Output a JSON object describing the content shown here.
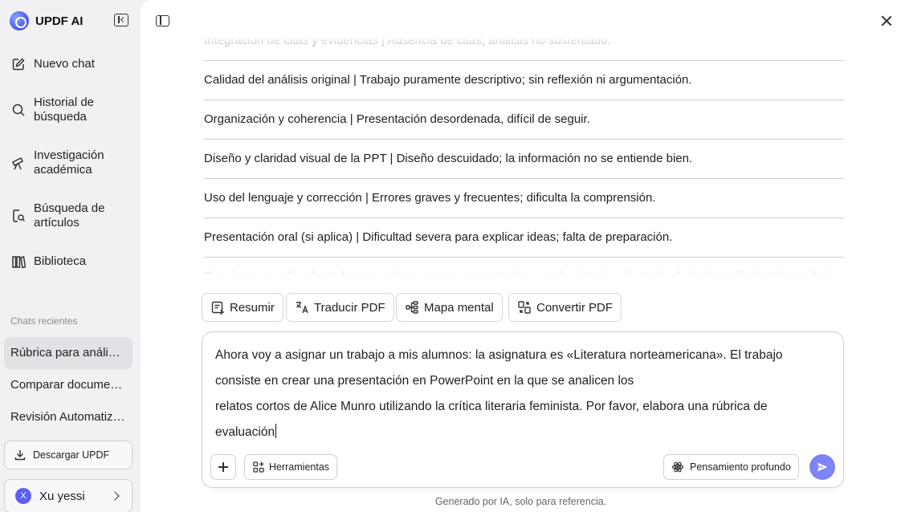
{
  "brand": {
    "name": "UPDF AI"
  },
  "sidebar": {
    "nav": [
      {
        "label": "Nuevo chat",
        "icon": "edit-icon"
      },
      {
        "label": "Historial de búsqueda",
        "icon": "search-icon"
      },
      {
        "label": "Investigación académica",
        "icon": "telescope-icon"
      },
      {
        "label": "Búsqueda de artículos",
        "icon": "document-search-icon"
      },
      {
        "label": "Biblioteca",
        "icon": "library-icon"
      }
    ],
    "recent_label": "Chats recientes",
    "recent": [
      "Rúbrica para análisis de presentación",
      "Comparar documentos",
      "Revisión Automatizada"
    ],
    "download_label": "Descargar UPDF",
    "user": {
      "initial": "X",
      "name": "Xu yessi"
    }
  },
  "chat": {
    "top_partial": "Integración de citas y evidencias | Ausencia de citas; análisis no sustentado.",
    "rows": [
      "Calidad del análisis original | Trabajo puramente descriptivo; sin reflexión ni argumentación.",
      "Organización y coherencia | Presentación desordenada, difícil de seguir.",
      "Diseño y claridad visual de la PPT | Diseño descuidado; la información no se entiende bien.",
      "Uso del lenguaje y corrección | Errores graves y frecuentes; dificulta la comprensión.",
      "Presentación oral (si aplica) | Dificultad severa para explicar ideas; falta de preparación."
    ],
    "bottom_partial": "Si quieres, puedo adaptarla para asignar pesos porcentuales a cada criterio o ajustarla al nivel académico (secundaria"
  },
  "tools": [
    {
      "label": "Resumir",
      "icon": "summarize-icon"
    },
    {
      "label": "Traducir PDF",
      "icon": "translate-icon"
    },
    {
      "label": "Mapa mental",
      "icon": "mindmap-icon"
    },
    {
      "label": "Convertir PDF",
      "icon": "convert-icon"
    }
  ],
  "composer": {
    "lines": [
      "Ahora voy a asignar un trabajo a mis alumnos: la asignatura es «Literatura norteamericana». El trabajo",
      "consiste en crear una presentación en PowerPoint en la que se analicen los",
      "relatos cortos de Alice Munro utilizando la crítica literaria feminista. Por favor, elabora una rúbrica de",
      "evaluación"
    ],
    "tools_label": "Herramientas",
    "deep_label": "Pensamiento profundo"
  },
  "footer": "Generado por IA, solo para referencia.",
  "colors": {
    "accent": "#7d84f5",
    "avatar": "#5b5ff2",
    "sidebar_bg": "#f1f1f3"
  }
}
